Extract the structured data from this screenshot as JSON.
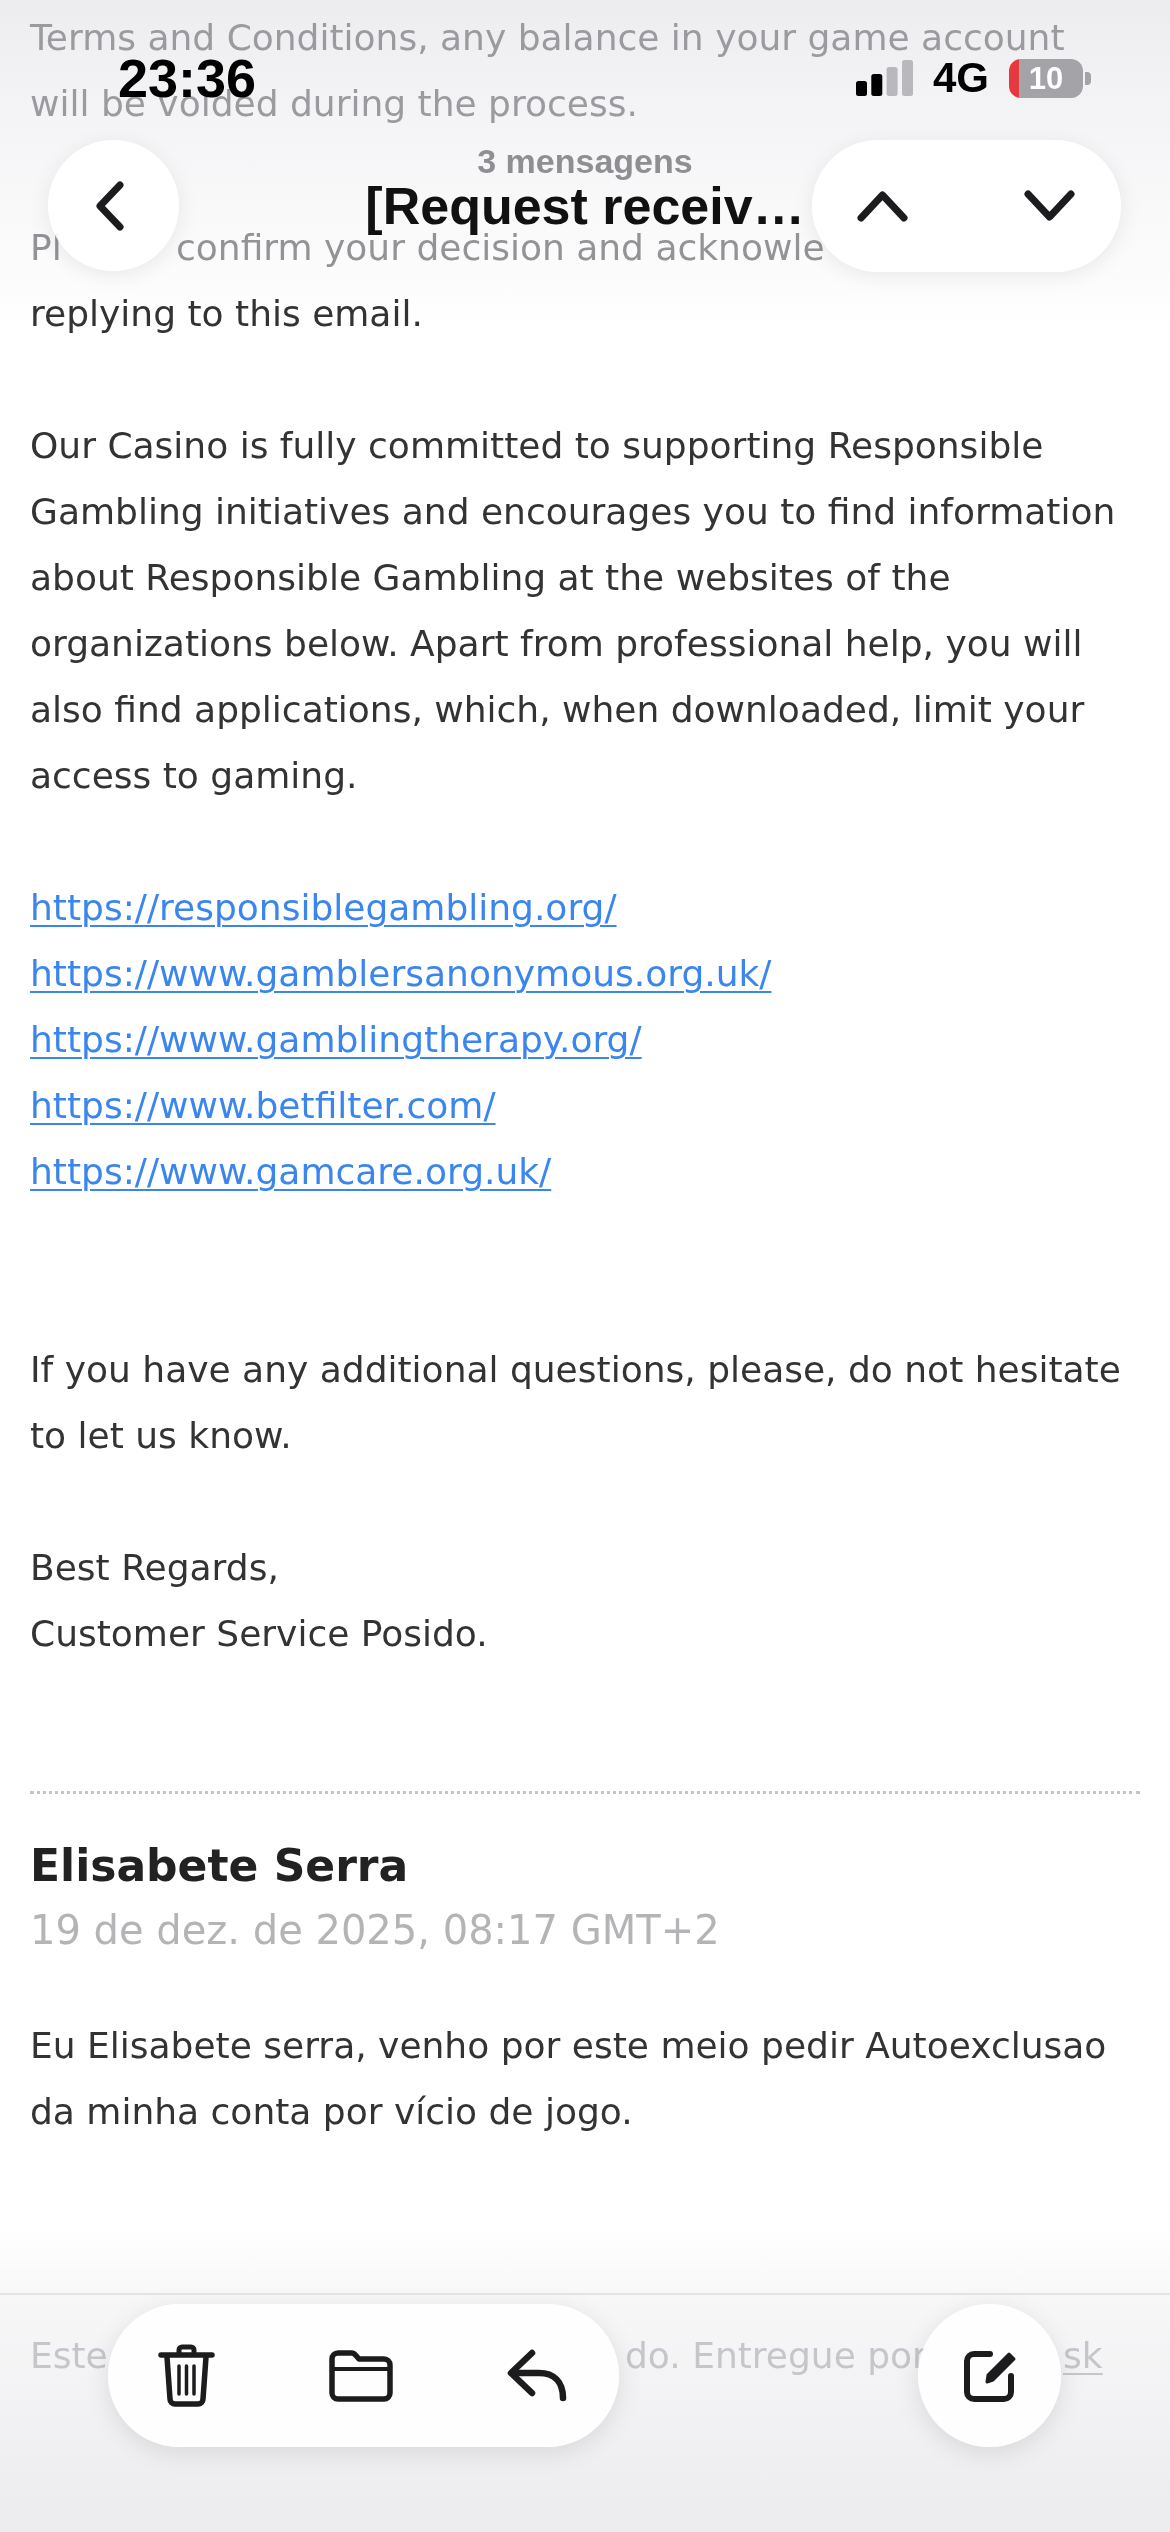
{
  "status_bar": {
    "time": "23:36",
    "network": "4G",
    "battery": "10"
  },
  "header": {
    "message_count": "3 mensagens",
    "subject": "[Request receiv…"
  },
  "email": {
    "blocks": [
      {
        "kind": "faded",
        "lines": [
          "Terms and Conditions, any balance in your game account",
          "will be voided during the process."
        ]
      },
      {
        "kind": "covered",
        "fragments": [
          "Pl",
          "confirm your decision and acknowle"
        ],
        "text": "replying to this email."
      },
      {
        "kind": "text",
        "text": "Our Casino is fully committed to supporting Responsible Gambling initiatives and encourages you to find information about Responsible Gambling at the websites of the organizations below. Apart from professional help, you will also find applications, which, when downloaded, limit your access to gaming."
      },
      {
        "kind": "links",
        "links": [
          "https://responsiblegambling.org/",
          "https://www.gamblersanonymous.org.uk/",
          "https://www.gamblingtherapy.org/",
          "https://www.betfilter.com/",
          "https://www.gamcare.org.uk/"
        ]
      },
      {
        "kind": "text",
        "text": "If you have any additional questions, please, do not hesitate to let us know."
      },
      {
        "kind": "lines",
        "lines": [
          "Best Regards,",
          "Customer Service Posido."
        ]
      }
    ]
  },
  "reply": {
    "sender": "Elisabete Serra",
    "date": "19 de dez. de 2025, 08:17 GMT+2",
    "body": "Eu Elisabete serra, venho por este meio pedir Autoexclusao da minha conta por vício de jogo."
  },
  "footer": {
    "fragments": [
      {
        "kind": "text",
        "text": "Este"
      },
      {
        "kind": "text",
        "text": "do. Entregue por"
      },
      {
        "kind": "link",
        "text": "sk"
      }
    ]
  }
}
